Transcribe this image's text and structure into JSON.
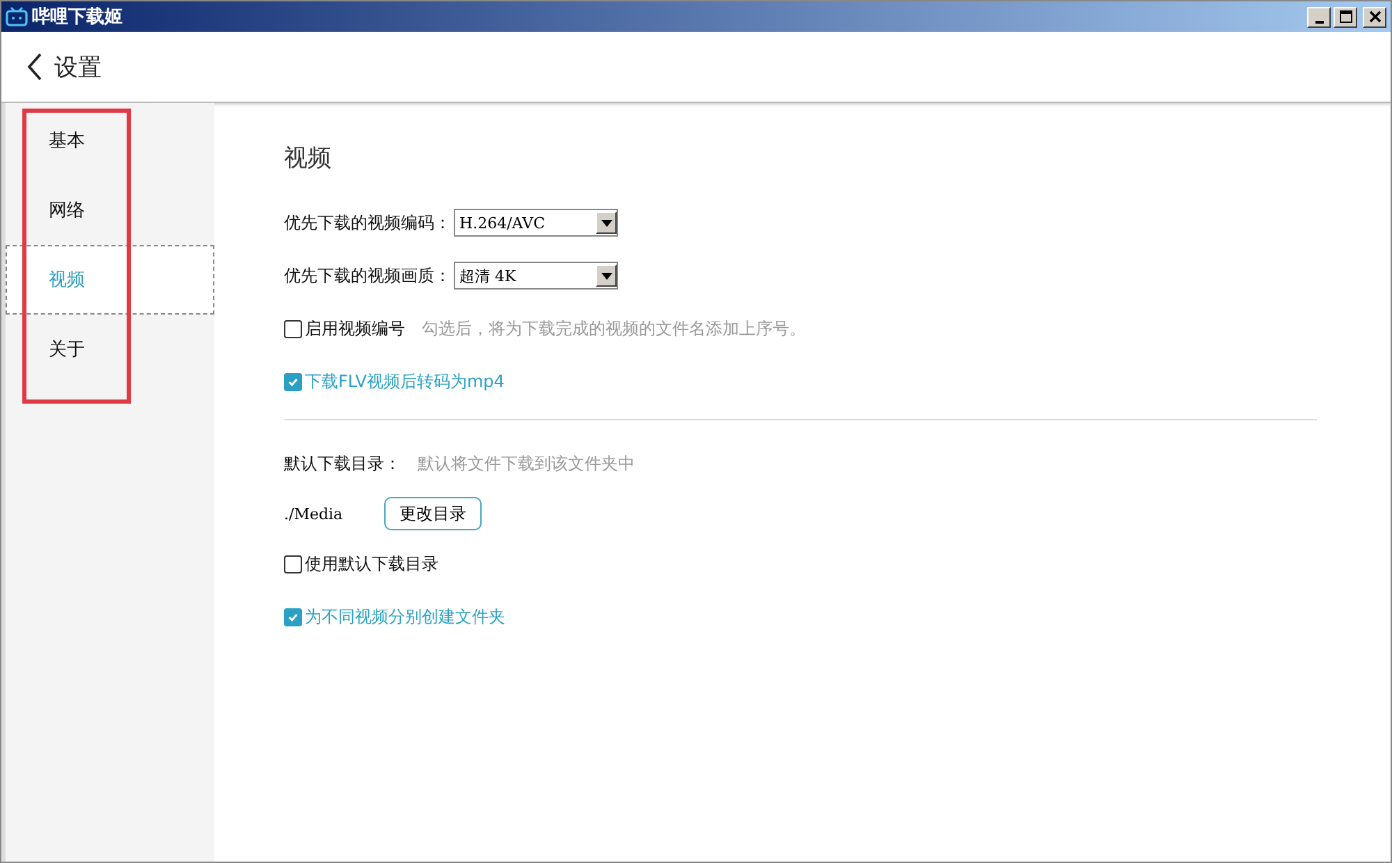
{
  "window": {
    "title": "哔哩下载姬"
  },
  "header": {
    "title": "设置"
  },
  "sidebar": {
    "items": [
      {
        "label": "基本",
        "selected": false
      },
      {
        "label": "网络",
        "selected": false
      },
      {
        "label": "视频",
        "selected": true
      },
      {
        "label": "关于",
        "selected": false
      }
    ]
  },
  "section": {
    "title": "视频"
  },
  "selects": [
    {
      "label": "优先下载的视频编码：",
      "value": "H.264/AVC"
    },
    {
      "label": "优先下载的视频画质：",
      "value": "超清 4K"
    }
  ],
  "options1": [
    {
      "label": "启用视频编号",
      "checked": false,
      "hint": "勾选后，将为下载完成的视频的文件名添加上序号。"
    },
    {
      "label": "下载FLV视频后转码为mp4",
      "checked": true
    }
  ],
  "directory": {
    "label": "默认下载目录：",
    "hint": "默认将文件下载到该文件夹中",
    "path": "./Media",
    "button": "更改目录"
  },
  "options2": [
    {
      "label": "使用默认下载目录",
      "checked": false
    },
    {
      "label": "为不同视频分别创建文件夹",
      "checked": true
    }
  ]
}
